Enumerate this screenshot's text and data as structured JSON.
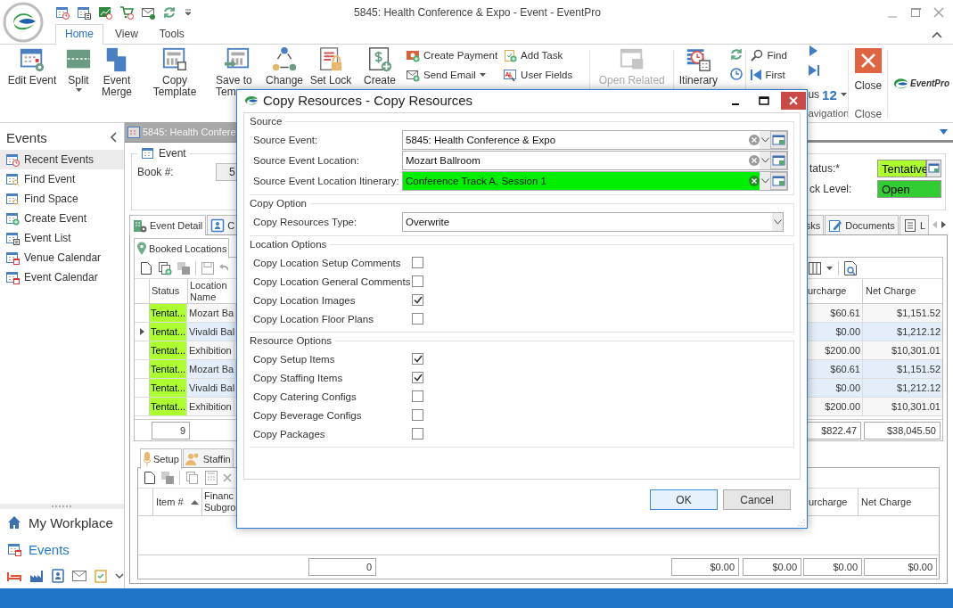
{
  "window": {
    "title": "5845: Health Conference & Expo - Event - EventPro"
  },
  "ribbon_tabs": [
    {
      "label": "Home",
      "selected": true
    },
    {
      "label": "View",
      "selected": false
    },
    {
      "label": "Tools",
      "selected": false
    }
  ],
  "ribbon": {
    "large_buttons": [
      {
        "label": "Edit Event",
        "dropdown": false
      },
      {
        "label": "Split",
        "dropdown": true
      },
      {
        "label": "Event Merge",
        "dropdown": false
      },
      {
        "label": "Copy Template",
        "dropdown": false
      },
      {
        "label": "Save to Tem",
        "dropdown": false
      },
      {
        "label": "Change",
        "dropdown": false
      },
      {
        "label": "Set Lock",
        "dropdown": false
      },
      {
        "label": "Create",
        "dropdown": false
      }
    ],
    "small_buttons": [
      {
        "label": "Create Payment",
        "dropdown": false
      },
      {
        "label": "Send Email",
        "dropdown": true
      },
      {
        "label": "Add Task",
        "dropdown": false
      },
      {
        "label": "User Fields",
        "dropdown": false
      }
    ],
    "open_related": {
      "label": "Open Related",
      "disabled": true
    },
    "itinerary": {
      "label": "Itinerary"
    },
    "navigation": {
      "find": "Find",
      "first": "First",
      "previous": "us",
      "count": "12",
      "group_label": "avigation"
    },
    "close": {
      "label": "Close",
      "group_label": "Close"
    },
    "logo_text": "EventPro"
  },
  "sidebar": {
    "title": "Events",
    "items": [
      {
        "label": "Recent Events",
        "selected": true
      },
      {
        "label": "Find Event",
        "selected": false
      },
      {
        "label": "Find Space",
        "selected": false
      },
      {
        "label": "Create Event",
        "selected": false
      },
      {
        "label": "Event List",
        "selected": false
      },
      {
        "label": "Venue Calendar",
        "selected": false
      },
      {
        "label": "Event Calendar",
        "selected": false
      }
    ],
    "nav": [
      {
        "label": "My Workplace",
        "selected": false
      },
      {
        "label": "Events",
        "selected": true
      }
    ]
  },
  "document_tab": {
    "title": "5845: Health Confere"
  },
  "event": {
    "legend": "Event",
    "book_label": "Book #:",
    "book_value": "5",
    "status_label": "tatus:*",
    "status_value": "Tentative",
    "lock_label": "ck Level:",
    "lock_value": "Open"
  },
  "detail_tabs": {
    "left": [
      {
        "label": "Event Detail",
        "selected": true
      },
      {
        "label": "C",
        "selected": false
      }
    ],
    "right": [
      {
        "label": "sks",
        "selected": false
      },
      {
        "label": "Documents",
        "selected": false
      },
      {
        "label": "L",
        "selected": false
      }
    ]
  },
  "locations": {
    "tab": "Booked Locations",
    "columns": [
      "Status",
      "Location Name"
    ],
    "right_columns": [
      "urcharge",
      "Net Charge"
    ],
    "rows": [
      {
        "status": "Tentat...",
        "location": "Mozart Ba",
        "surcharge": "$60.61",
        "net_charge": "$1,151.52",
        "focused": false,
        "selected": false
      },
      {
        "status": "Tentat...",
        "location": "Vivaldi Bal",
        "surcharge": "$0.00",
        "net_charge": "$1,212.12",
        "focused": true,
        "selected": true
      },
      {
        "status": "Tentat...",
        "location": "Exhibition",
        "surcharge": "$200.00",
        "net_charge": "$10,301.01",
        "focused": false,
        "selected": false
      },
      {
        "status": "Tentat...",
        "location": "Mozart Ba",
        "surcharge": "$60.61",
        "net_charge": "$1,151.52",
        "focused": false,
        "selected": true
      },
      {
        "status": "Tentat...",
        "location": "Vivaldi Bal",
        "surcharge": "$0.00",
        "net_charge": "$1,212.12",
        "focused": false,
        "selected": true
      },
      {
        "status": "Tentat...",
        "location": "Exhibition",
        "surcharge": "$200.00",
        "net_charge": "$10,301.01",
        "focused": false,
        "selected": false
      }
    ],
    "footer": {
      "count": "9",
      "surcharge": "$822.47",
      "net_charge": "$38,045.50"
    }
  },
  "resources": {
    "tabs": [
      {
        "label": "Setup",
        "selected": true
      },
      {
        "label": "Staffin",
        "selected": false
      }
    ],
    "columns": [
      "Item #",
      "Financ Subgro"
    ],
    "right_columns": [
      "urcharge",
      "Net Charge"
    ],
    "footer": [
      "0",
      "$0.00",
      "$0.00",
      "$0.00",
      "$0.00"
    ]
  },
  "dialog": {
    "title": "Copy Resources - Copy Resources",
    "sections": [
      {
        "kind": "lookups",
        "legend": "Source",
        "fields": [
          {
            "label": "Source Event:",
            "value": "5845: Health Conference & Expo",
            "highlighted": false
          },
          {
            "label": "Source Event Location:",
            "value": "Mozart Ballroom",
            "highlighted": false
          },
          {
            "label": "Source Event Location Itinerary:",
            "value": "Conference Track A, Session 1",
            "highlighted": true
          }
        ]
      },
      {
        "kind": "combo",
        "legend": "Copy Option",
        "fields": [
          {
            "label": "Copy Resources Type:",
            "value": "Overwrite"
          }
        ]
      },
      {
        "kind": "checks",
        "legend": "Location Options",
        "options": [
          {
            "label": "Copy Location Setup Comments",
            "checked": false
          },
          {
            "label": "Copy Location General Comments",
            "checked": false
          },
          {
            "label": "Copy Location Images",
            "checked": true
          },
          {
            "label": "Copy Location Floor Plans",
            "checked": false
          }
        ]
      },
      {
        "kind": "checks",
        "legend": "Resource Options",
        "options": [
          {
            "label": "Copy Setup Items",
            "checked": true
          },
          {
            "label": "Copy Staffing Items",
            "checked": true
          },
          {
            "label": "Copy Catering Configs",
            "checked": false
          },
          {
            "label": "Copy Beverage Configs",
            "checked": false
          },
          {
            "label": "Copy Packages",
            "checked": false
          }
        ]
      }
    ],
    "buttons": [
      {
        "label": "OK",
        "default": true
      },
      {
        "label": "Cancel",
        "default": false
      }
    ]
  }
}
